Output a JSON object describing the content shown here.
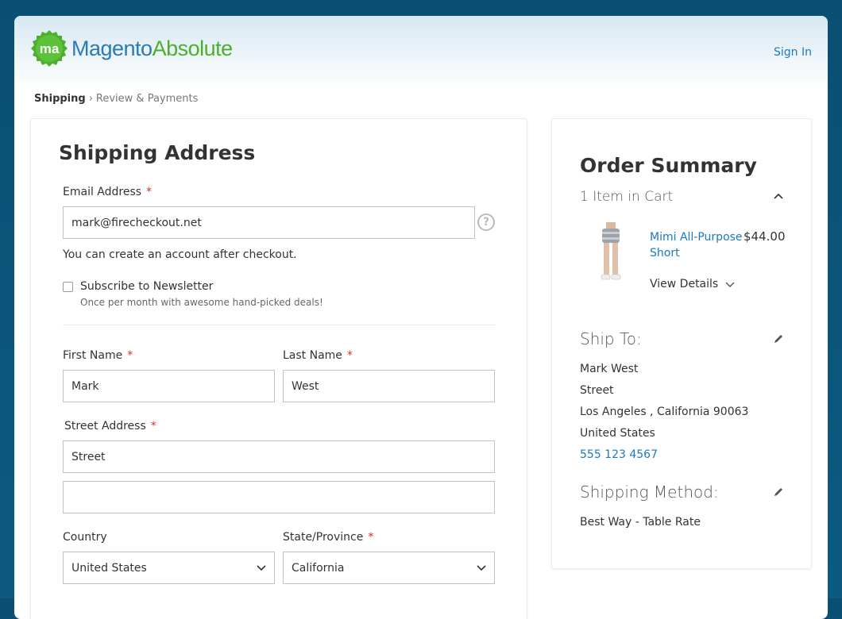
{
  "header": {
    "logo_mark": "ma",
    "logo_word_a": "Magento",
    "logo_word_b": "Absolute",
    "sign_in": "Sign In"
  },
  "breadcrumb": {
    "current": "Shipping",
    "separator": "›",
    "next": "Review & Payments"
  },
  "shipping": {
    "title": "Shipping Address",
    "required_mark": "*",
    "email": {
      "label": "Email Address",
      "value": "mark@firecheckout.net",
      "help_glyph": "?",
      "note": "You can create an account after checkout."
    },
    "newsletter": {
      "label": "Subscribe to Newsletter",
      "note": "Once per month with awesome hand-picked deals!",
      "checked": false
    },
    "first_name": {
      "label": "First Name",
      "value": "Mark"
    },
    "last_name": {
      "label": "Last Name",
      "value": "West"
    },
    "street": {
      "label": "Street Address",
      "line1": "Street",
      "line2": ""
    },
    "country": {
      "label": "Country",
      "value": "United States"
    },
    "state": {
      "label": "State/Province",
      "value": "California"
    }
  },
  "summary": {
    "title": "Order Summary",
    "items_toggle": "1 Item in Cart",
    "item": {
      "name": "Mimi All-Purpose Short",
      "price": "$44.00",
      "view_details": "View Details"
    },
    "ship_to": {
      "title": "Ship To:",
      "name": "Mark West",
      "street": "Street",
      "city_line": "Los Angeles , California 90063",
      "country": "United States",
      "phone": "555 123 4567"
    },
    "shipping_method": {
      "title": "Shipping Method:",
      "value": "Best Way - Table Rate"
    }
  },
  "colors": {
    "background": "#0c5a80",
    "link": "#1979c3",
    "required": "#e02b27",
    "logo_green": "#4caf2d",
    "logo_blue": "#2a7ab3"
  },
  "icons": [
    "logo-badge-icon",
    "help-icon",
    "chevron-down-icon",
    "chevron-up-icon",
    "pencil-icon",
    "product-thumbnail"
  ]
}
